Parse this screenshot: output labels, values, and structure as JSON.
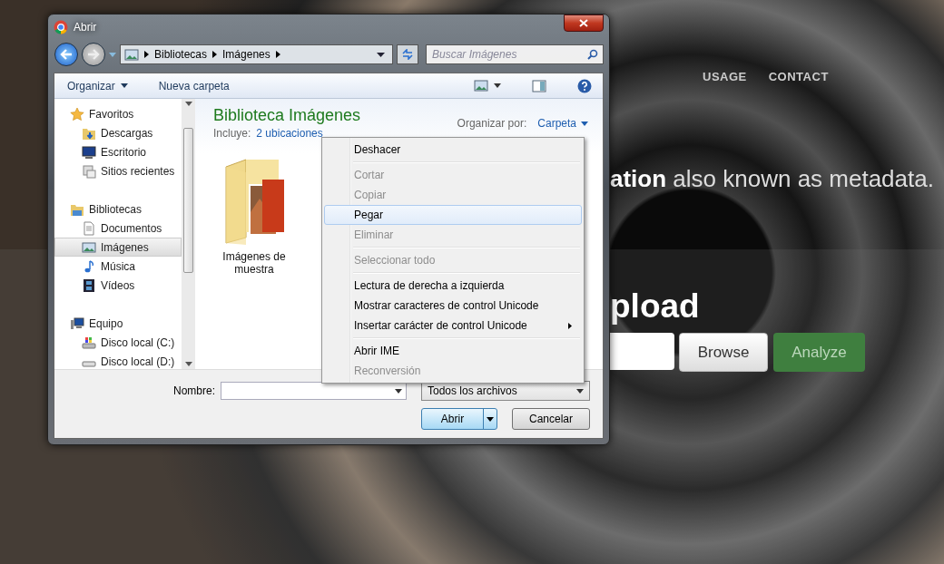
{
  "web_page": {
    "nav": [
      {
        "label": "USAGE"
      },
      {
        "label": "CONTACT"
      }
    ],
    "tagline": "**ation** also known as metadata.",
    "upload_heading": "pload",
    "browse_button": "Browse",
    "analyze_button": "Analyze"
  },
  "dialog": {
    "title": "Abrir",
    "breadcrumb": [
      "Bibliotecas",
      "Imágenes"
    ],
    "search": {
      "placeholder": "Buscar Imágenes"
    },
    "toolbar": {
      "organize": "Organizar",
      "new_folder": "Nueva carpeta"
    },
    "sidebar": [
      {
        "label": "Favoritos",
        "kind": "star",
        "selected": false,
        "children": [
          {
            "label": "Descargas",
            "kind": "downloads",
            "selected": false
          },
          {
            "label": "Escritorio",
            "kind": "desktop",
            "selected": false
          },
          {
            "label": "Sitios recientes",
            "kind": "recent",
            "selected": false
          }
        ]
      },
      {
        "label": "Bibliotecas",
        "kind": "library",
        "selected": false,
        "children": [
          {
            "label": "Documentos",
            "kind": "document",
            "selected": false
          },
          {
            "label": "Imágenes",
            "kind": "pictures",
            "selected": true
          },
          {
            "label": "Música",
            "kind": "music",
            "selected": false
          },
          {
            "label": "Vídeos",
            "kind": "video",
            "selected": false
          }
        ]
      },
      {
        "label": "Equipo",
        "kind": "computer",
        "selected": false,
        "children": [
          {
            "label": "Disco local (C:)",
            "kind": "system-drive",
            "selected": false
          },
          {
            "label": "Disco local (D:)",
            "kind": "drive",
            "selected": false
          }
        ]
      }
    ],
    "library": {
      "title": "Biblioteca Imágenes",
      "includes_label": "Incluye:",
      "includes_link": "2 ubicaciones",
      "arrange_label": "Organizar por:",
      "arrange_value": "Carpeta"
    },
    "files": [
      {
        "name": "Imágenes de muestra"
      }
    ],
    "filename_label": "Nombre:",
    "filter": "Todos los archivos",
    "open_button": "Abrir",
    "cancel_button": "Cancelar"
  },
  "context_menu": [
    {
      "kind": "item",
      "label": "Deshacer",
      "disabled": false,
      "selected": false,
      "submenu": false
    },
    {
      "kind": "separator"
    },
    {
      "kind": "item",
      "label": "Cortar",
      "disabled": true,
      "selected": false,
      "submenu": false
    },
    {
      "kind": "item",
      "label": "Copiar",
      "disabled": true,
      "selected": false,
      "submenu": false
    },
    {
      "kind": "item",
      "label": "Pegar",
      "disabled": false,
      "selected": true,
      "submenu": false
    },
    {
      "kind": "item",
      "label": "Eliminar",
      "disabled": true,
      "selected": false,
      "submenu": false
    },
    {
      "kind": "separator"
    },
    {
      "kind": "item",
      "label": "Seleccionar todo",
      "disabled": true,
      "selected": false,
      "submenu": false
    },
    {
      "kind": "separator"
    },
    {
      "kind": "item",
      "label": "Lectura de derecha a izquierda",
      "disabled": false,
      "selected": false,
      "submenu": false
    },
    {
      "kind": "item",
      "label": "Mostrar caracteres de control Unicode",
      "disabled": false,
      "selected": false,
      "submenu": false
    },
    {
      "kind": "item",
      "label": "Insertar carácter de control Unicode",
      "disabled": false,
      "selected": false,
      "submenu": true
    },
    {
      "kind": "separator"
    },
    {
      "kind": "item",
      "label": "Abrir IME",
      "disabled": false,
      "selected": false,
      "submenu": false
    },
    {
      "kind": "item",
      "label": "Reconversión",
      "disabled": true,
      "selected": false,
      "submenu": false
    }
  ]
}
